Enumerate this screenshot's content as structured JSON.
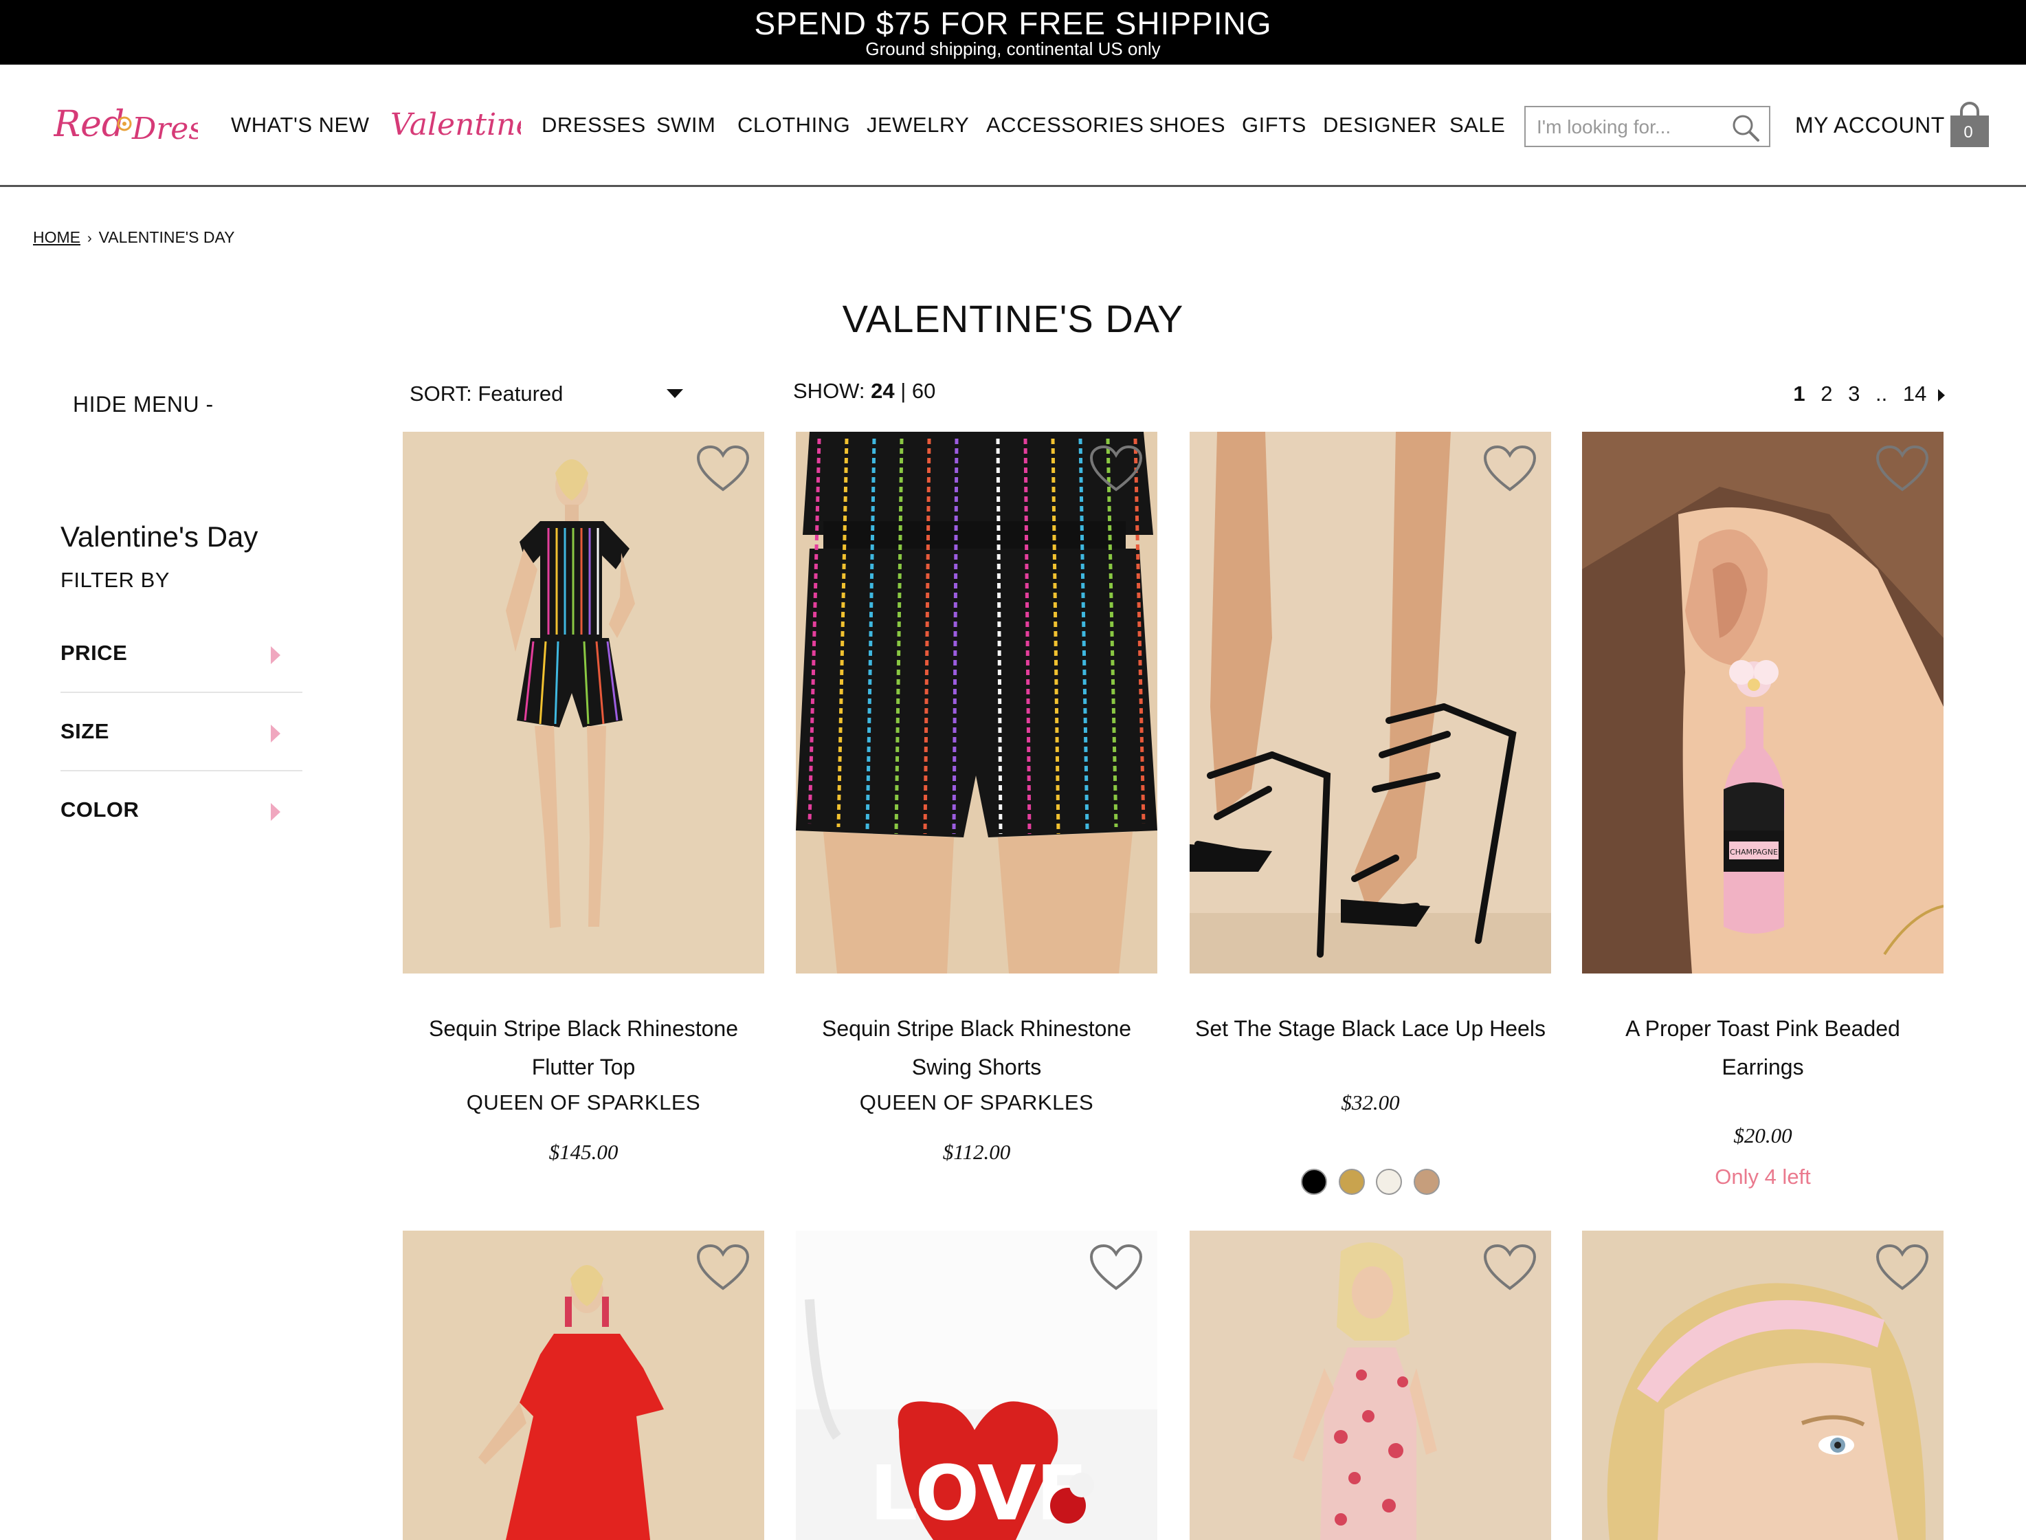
{
  "promo": {
    "main": "SPEND $75 FOR FREE SHIPPING",
    "sub": "Ground shipping, continental US only"
  },
  "header": {
    "logo_text": "Red Dress",
    "nav": [
      "WHAT'S NEW",
      "Valentine's",
      "DRESSES",
      "SWIM",
      "CLOTHING",
      "JEWELRY",
      "ACCESSORIES",
      "SHOES",
      "GIFTS",
      "DESIGNER",
      "SALE"
    ],
    "search_placeholder": "I'm looking for...",
    "account": "MY ACCOUNT",
    "cart_count": "0"
  },
  "breadcrumb": {
    "home": "HOME",
    "separator": "›",
    "current": "VALENTINE'S DAY"
  },
  "page_title": "VALENTINE'S DAY",
  "sidebar": {
    "hide_menu": "HIDE MENU -",
    "title": "Valentine's Day",
    "filter_by": "FILTER BY",
    "filters": [
      "PRICE",
      "SIZE",
      "COLOR"
    ]
  },
  "toolbar": {
    "sort_label": "SORT: Featured",
    "show_label": "SHOW:",
    "show_selected": "24",
    "show_divider": "|",
    "show_other": "60",
    "pages": [
      "1",
      "2",
      "3",
      "..",
      "14"
    ],
    "current_page": "1"
  },
  "products": [
    {
      "name": "Sequin Stripe Black Rhinestone Flutter Top",
      "brand": "QUEEN OF SPARKLES",
      "price": "$145.00",
      "icon": "heart-icon"
    },
    {
      "name": "Sequin Stripe Black Rhinestone Swing Shorts",
      "brand": "QUEEN OF SPARKLES",
      "price": "$112.00",
      "icon": "heart-icon"
    },
    {
      "name": "Set The Stage Black Lace Up Heels",
      "price": "$32.00",
      "swatches": [
        "#000000",
        "#c9a34e",
        "#f3efe6",
        "#c69e7c"
      ],
      "icon": "heart-icon"
    },
    {
      "name": "A Proper Toast Pink Beaded Earrings",
      "price": "$20.00",
      "stock": "Only 4 left",
      "icon": "heart-icon"
    }
  ],
  "products_row2": [
    "red-dress",
    "love-heart-clutch",
    "floral-halter-dress",
    "pink-headband"
  ],
  "colors": {
    "accent_pink": "#d63a77",
    "stock_text": "#ea7a8e",
    "filter_arrow": "#f0a7bf",
    "promo_bg": "#000000"
  }
}
